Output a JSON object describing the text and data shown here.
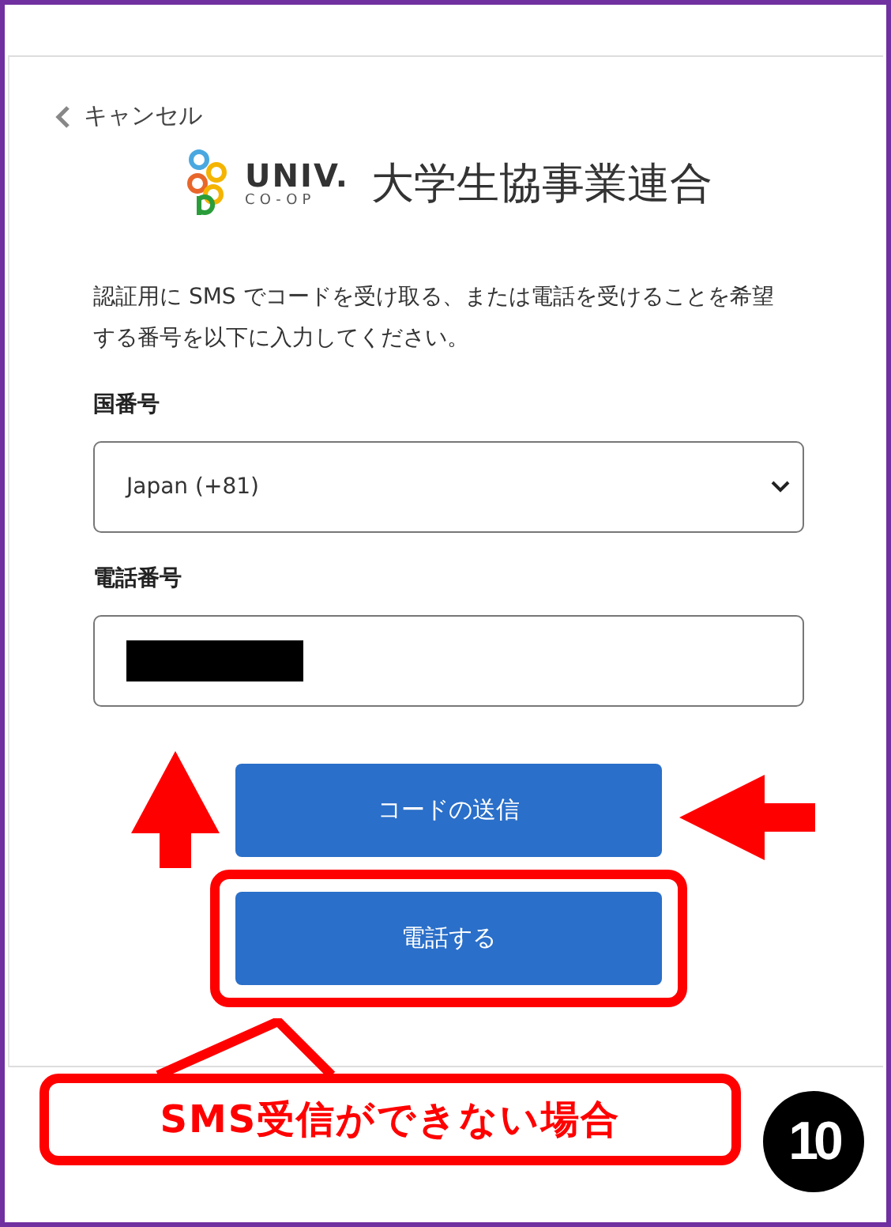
{
  "back_link": {
    "label": "キャンセル"
  },
  "logo": {
    "wordmark": "UNIV.",
    "subtitle": "CO-OP",
    "name": "大学生協事業連合"
  },
  "intro": "認証用に SMS でコードを受け取る、または電話を受けることを希望する番号を以下に入力してください。",
  "country_field": {
    "label": "国番号",
    "value": "Japan (+81)"
  },
  "phone_field": {
    "label": "電話番号",
    "redacted": true
  },
  "buttons": [
    {
      "label": "コードの送信",
      "highlighted": false
    },
    {
      "label": "電話する",
      "highlighted": true
    }
  ],
  "annotations": {
    "callout": "SMS受信ができない場合",
    "step": "10"
  }
}
